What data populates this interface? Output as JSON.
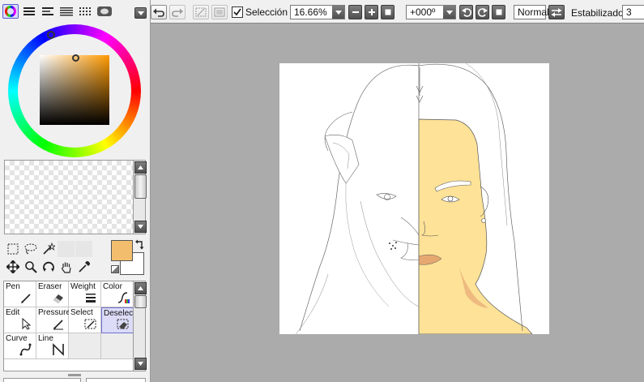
{
  "toolbar": {
    "selection_label": "Selección",
    "selection_checked": true,
    "zoom_value": "16.66%",
    "rotation_value": "+000º",
    "blend_mode": "Normal",
    "stabilizer_label": "Estabilizador",
    "stabilizer_value": "3"
  },
  "colors": {
    "primary": "#f2be6e",
    "secondary": "#ffffff",
    "canvas_bg": "#ababab",
    "skin": "#fde297",
    "lips": "#e6a870",
    "shadow": "#eab07a"
  },
  "icons": {
    "palette_tabs": [
      "color-wheel-icon",
      "rgb-sliders-icon",
      "hsv-sliders-icon",
      "swatches-icon",
      "scratchpad-icon",
      "picture-icon"
    ],
    "nav": [
      "undo-icon",
      "redo-icon",
      "clear-icon",
      "transform-icon"
    ],
    "tools_row1": [
      "rect-select-icon",
      "lasso-icon",
      "magic-wand-icon"
    ],
    "tools_row2": [
      "move-icon",
      "zoom-icon",
      "rotate-icon",
      "hand-icon",
      "eyedropper-icon"
    ]
  },
  "brushes": [
    {
      "label": "Pen",
      "icon": "pen-icon"
    },
    {
      "label": "Eraser",
      "icon": "eraser-icon"
    },
    {
      "label": "Weight",
      "icon": "weight-icon"
    },
    {
      "label": "Color",
      "icon": "color-icon"
    },
    {
      "label": "Edit",
      "icon": "edit-icon"
    },
    {
      "label": "Pressure",
      "icon": "pressure-icon"
    },
    {
      "label": "Select",
      "icon": "select-icon"
    },
    {
      "label": "Deselect",
      "icon": "deselect-icon"
    },
    {
      "label": "Curve",
      "icon": "curve-icon"
    },
    {
      "label": "Line",
      "icon": "line-icon"
    }
  ]
}
